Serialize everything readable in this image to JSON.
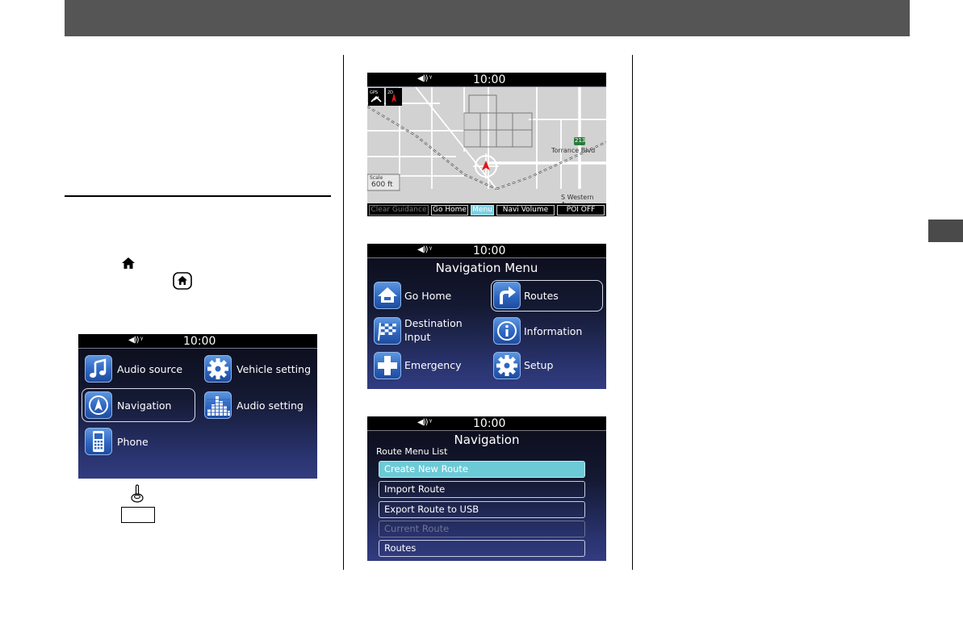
{
  "screens": {
    "status_time": "10:00",
    "status_icons": "◀)) ᵞ",
    "home": {
      "items": [
        {
          "label": "Audio source",
          "icon": "music-note-icon"
        },
        {
          "label": "Vehicle setting",
          "icon": "gear-icon"
        },
        {
          "label": "Navigation",
          "icon": "compass-icon",
          "selected": true
        },
        {
          "label": "Audio setting",
          "icon": "equalizer-icon"
        },
        {
          "label": "Phone",
          "icon": "phone-icon"
        }
      ]
    },
    "map": {
      "buttons": [
        "Clear Guidance",
        "Go Home",
        "Menu",
        "Navi Volume",
        "POI OFF"
      ],
      "scale_label": "Scale",
      "scale_value": "600 ft",
      "street_1": "Torrance Blvd",
      "street_2": "S Western Ave",
      "highway_shield": "213"
    },
    "nav_menu": {
      "title": "Navigation Menu",
      "items": [
        {
          "label": "Go Home",
          "icon": "house-icon"
        },
        {
          "label": "Routes",
          "icon": "turn-arrow-icon",
          "selected": true
        },
        {
          "label": "Destination Input",
          "label_line1": "Destination",
          "label_line2": "Input",
          "icon": "checkered-flag-icon"
        },
        {
          "label": "Information",
          "icon": "info-icon"
        },
        {
          "label": "Emergency",
          "icon": "plus-icon"
        },
        {
          "label": "Setup",
          "icon": "gear-icon"
        }
      ]
    },
    "route_menu": {
      "title": "Navigation",
      "subtitle": "Route Menu List",
      "items": [
        {
          "label": "Create New Route",
          "state": "highlighted"
        },
        {
          "label": "Import Route",
          "state": "normal"
        },
        {
          "label": "Export Route to USB",
          "state": "normal"
        },
        {
          "label": "Current Route",
          "state": "disabled"
        },
        {
          "label": "Routes",
          "state": "normal"
        }
      ]
    }
  },
  "colors": {
    "header_bar": "#555555",
    "highlight": "#6ccad6",
    "tile_blue": "#2e66c0"
  }
}
